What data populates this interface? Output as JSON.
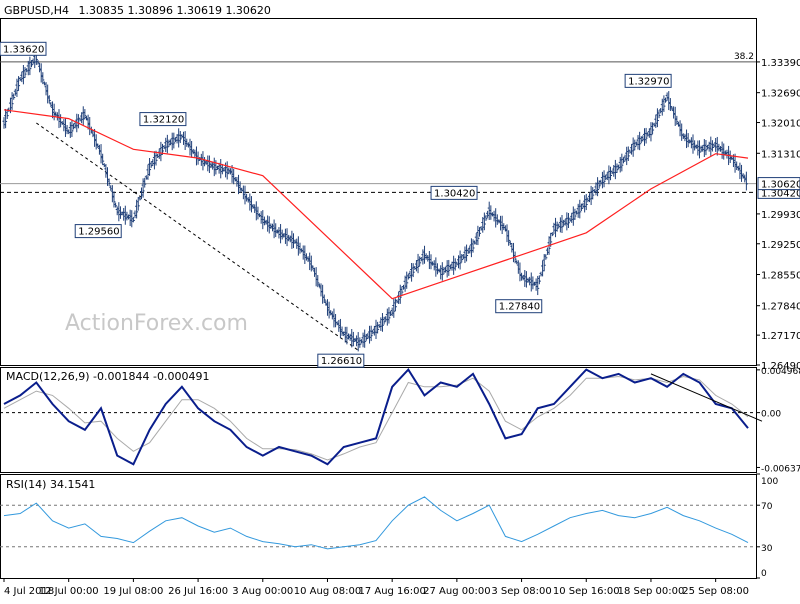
{
  "header": {
    "symbol": "GBPUSD,H4",
    "ohlc": "1.30835 1.30896 1.30619 1.30620"
  },
  "watermark": "ActionForex.com",
  "colors": {
    "candle": "#1f3f78",
    "sma": "#ff2020",
    "macd": "#0a1e8c",
    "macd_signal": "#aaaaaa",
    "rsi": "#3399dd",
    "guide": "#555555",
    "tag_border": "#1f3f78"
  },
  "chart_data": [
    {
      "type": "line",
      "panel": "price",
      "title": "GBPUSD,H4",
      "ylim": [
        1.2649,
        1.3439
      ],
      "y_ticks": [
        "1.33390",
        "1.32690",
        "1.32010",
        "1.31310",
        "1.30620",
        "1.30420",
        "1.29930",
        "1.29250",
        "1.28550",
        "1.27840",
        "1.27170",
        "1.26490"
      ],
      "x_ticks": [
        "4 Jul 2018",
        "12 Jul 00:00",
        "19 Jul 08:00",
        "26 Jul 16:00",
        "3 Aug 00:00",
        "10 Aug 08:00",
        "17 Aug 16:00",
        "27 Aug 00:00",
        "3 Sep 08:00",
        "10 Sep 16:00",
        "18 Sep 00:00",
        "25 Sep 08:00"
      ],
      "series": [
        {
          "x": [
            "4 Jul 2018",
            "6 Jul 2018",
            "9 Jul 2018",
            "10 Jul 2018",
            "12 Jul 00:00",
            "13 Jul 2018",
            "16 Jul 2018",
            "17 Jul 2018",
            "19 Jul 08:00",
            "20 Jul 2018",
            "23 Jul 2018",
            "25 Jul 2018",
            "26 Jul 16:00",
            "30 Jul 2018",
            "31 Jul 2018",
            "1 Aug 2018",
            "3 Aug 00:00",
            "6 Aug 2018",
            "7 Aug 2018",
            "8 Aug 2018",
            "10 Aug 08:00",
            "13 Aug 2018",
            "14 Aug 2018",
            "15 Aug 2018",
            "17 Aug 16:00",
            "21 Aug 2018",
            "22 Aug 2018",
            "24 Aug 2018",
            "27 Aug 00:00",
            "28 Aug 2018",
            "30 Aug 2018",
            "31 Aug 2018",
            "3 Sep 08:00",
            "4 Sep 2018",
            "5 Sep 2018",
            "6 Sep 2018",
            "10 Sep 16:00",
            "12 Sep 2018",
            "13 Sep 2018",
            "14 Sep 2018",
            "18 Sep 00:00",
            "19 Sep 2018",
            "20 Sep 2018",
            "21 Sep 2018",
            "25 Sep 08:00",
            "26 Sep 2018",
            "27 Sep 2018"
          ],
          "values": [
            1.32,
            1.33,
            1.335,
            1.323,
            1.318,
            1.322,
            1.313,
            1.3,
            1.298,
            1.31,
            1.315,
            1.317,
            1.312,
            1.31,
            1.309,
            1.303,
            1.298,
            1.295,
            1.293,
            1.288,
            1.278,
            1.272,
            1.27,
            1.273,
            1.277,
            1.285,
            1.29,
            1.286,
            1.288,
            1.292,
            1.3,
            1.296,
            1.285,
            1.283,
            1.296,
            1.298,
            1.302,
            1.307,
            1.31,
            1.315,
            1.318,
            1.326,
            1.317,
            1.314,
            1.315,
            1.312,
            1.3062
          ]
        },
        {
          "name": "SMA",
          "x": [
            "4 Jul 2018",
            "12 Jul 00:00",
            "19 Jul 08:00",
            "26 Jul 16:00",
            "3 Aug 00:00",
            "10 Aug 08:00",
            "17 Aug 16:00",
            "27 Aug 00:00",
            "3 Sep 08:00",
            "10 Sep 16:00",
            "18 Sep 00:00",
            "25 Sep 08:00",
            "27 Sep 2018"
          ],
          "values": [
            1.323,
            1.321,
            1.314,
            1.312,
            1.308,
            1.294,
            1.28,
            1.285,
            1.29,
            1.295,
            1.305,
            1.313,
            1.312
          ]
        }
      ],
      "annotations": [
        "1.33620",
        "1.29560",
        "1.32120",
        "1.26610",
        "1.30420",
        "1.27840",
        "1.32970"
      ],
      "horizontal_lines": [
        {
          "value": 1.3339,
          "label": "38.2"
        },
        {
          "value": 1.3042,
          "label": "1.30420"
        },
        {
          "value": 1.3062,
          "label": "1.30620"
        }
      ],
      "trendline": {
        "from": {
          "x": "9 Jul 2018",
          "y": 1.32
        },
        "to": {
          "x": "14 Aug 2018",
          "y": 1.268
        }
      }
    },
    {
      "type": "line",
      "panel": "macd",
      "title": "MACD(12,26,9) -0.001844 -0.000491",
      "ylim": [
        -0.0069,
        0.0053
      ],
      "y_ticks": [
        "0.004968",
        "0.00",
        "-0.006372"
      ],
      "series": [
        {
          "values": [
            0.001,
            0.002,
            0.0035,
            0.001,
            -0.001,
            -0.002,
            0.0005,
            -0.005,
            -0.006,
            -0.002,
            0.001,
            0.003,
            0.0005,
            -0.001,
            -0.002,
            -0.004,
            -0.005,
            -0.004,
            -0.0045,
            -0.005,
            -0.006,
            -0.004,
            -0.0035,
            -0.003,
            0.003,
            0.005,
            0.002,
            0.0035,
            0.003,
            0.0045,
            0.001,
            -0.003,
            -0.0025,
            0.0005,
            0.001,
            0.003,
            0.005,
            0.004,
            0.0045,
            0.0035,
            0.004,
            0.003,
            0.0045,
            0.0035,
            0.001,
            0.0005,
            -0.0018
          ]
        },
        {
          "values": [
            0.0005,
            0.0015,
            0.0025,
            0.002,
            0.0005,
            -0.0012,
            -0.001,
            -0.003,
            -0.0045,
            -0.0035,
            -0.001,
            0.0015,
            0.0015,
            0.0005,
            -0.001,
            -0.003,
            -0.0042,
            -0.0042,
            -0.0043,
            -0.0048,
            -0.0055,
            -0.0048,
            -0.004,
            -0.0035,
            0.0,
            0.0035,
            0.003,
            0.003,
            0.0032,
            0.004,
            0.0025,
            -0.001,
            -0.002,
            -0.0005,
            0.0005,
            0.002,
            0.004,
            0.004,
            0.0042,
            0.0038,
            0.004,
            0.0035,
            0.0042,
            0.0038,
            0.002,
            0.001,
            -0.0005
          ]
        }
      ],
      "trendline": {
        "from": {
          "x": "18 Sep 00:00",
          "y": 0.0045
        },
        "to": {
          "x": "27 Sep 2018",
          "y": -0.001
        }
      }
    },
    {
      "type": "line",
      "panel": "rsi",
      "title": "RSI(14) 34.1541",
      "ylim": [
        0,
        100
      ],
      "y_ticks": [
        "100",
        "70",
        "30",
        "0"
      ],
      "horizontal_lines": [
        {
          "value": 70
        },
        {
          "value": 30
        }
      ],
      "series": [
        {
          "values": [
            60,
            62,
            72,
            55,
            48,
            52,
            40,
            38,
            34,
            45,
            55,
            58,
            50,
            44,
            48,
            40,
            35,
            33,
            30,
            32,
            28,
            30,
            32,
            36,
            55,
            70,
            78,
            65,
            55,
            62,
            70,
            40,
            35,
            42,
            50,
            58,
            62,
            65,
            60,
            58,
            62,
            68,
            60,
            55,
            48,
            42,
            34
          ]
        }
      ]
    }
  ]
}
